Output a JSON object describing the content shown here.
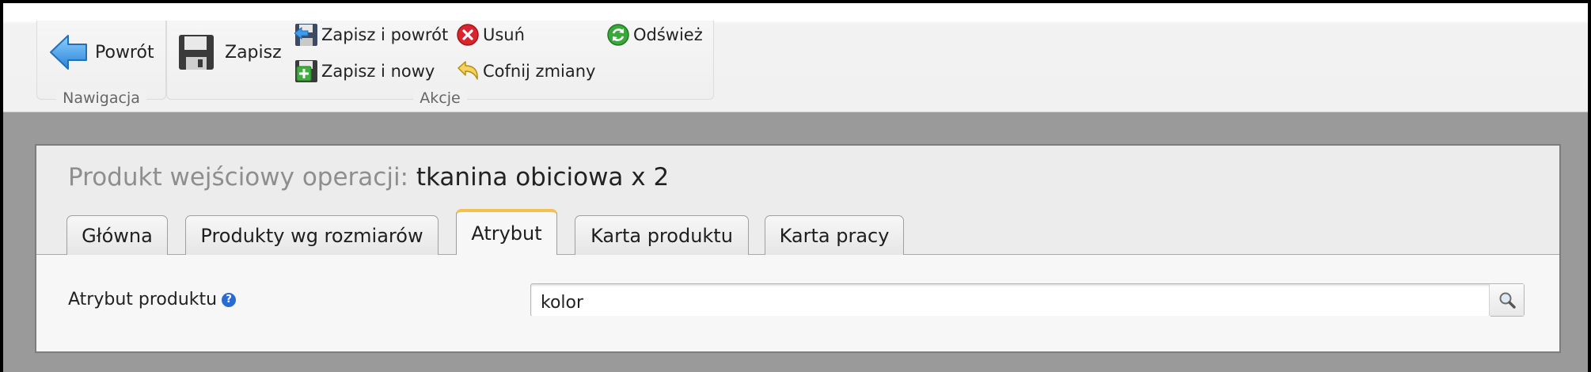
{
  "ribbon": {
    "groups": {
      "navigation": "Nawigacja",
      "actions": "Akcje"
    },
    "buttons": {
      "back": "Powrót",
      "save": "Zapisz",
      "save_and_back": "Zapisz i powrót",
      "save_and_new": "Zapisz i nowy",
      "delete": "Usuń",
      "undo": "Cofnij zmiany",
      "refresh": "Odśwież"
    },
    "icons": {
      "back": "back-arrow-icon",
      "save": "floppy-disk-icon",
      "save_and_back": "save-back-icon",
      "save_and_new": "save-new-icon",
      "delete": "delete-icon",
      "undo": "undo-icon",
      "refresh": "refresh-icon"
    }
  },
  "form": {
    "title_prefix": "Produkt wejściowy operacji:",
    "title_value": "tkanina obiciowa x 2",
    "tabs": [
      {
        "label": "Główna",
        "active": false
      },
      {
        "label": "Produkty wg rozmiarów",
        "active": false
      },
      {
        "label": "Atrybut",
        "active": true
      },
      {
        "label": "Karta produktu",
        "active": false
      },
      {
        "label": "Karta pracy",
        "active": false
      }
    ],
    "fields": {
      "product_attribute": {
        "label": "Atrybut produktu",
        "value": "kolor"
      }
    }
  },
  "colors": {
    "active_tab_accent": "#f2c14e",
    "back_arrow": "#3d9be9",
    "delete": "#d9262e",
    "refresh": "#3aa83a",
    "help": "#2a6bd1"
  }
}
